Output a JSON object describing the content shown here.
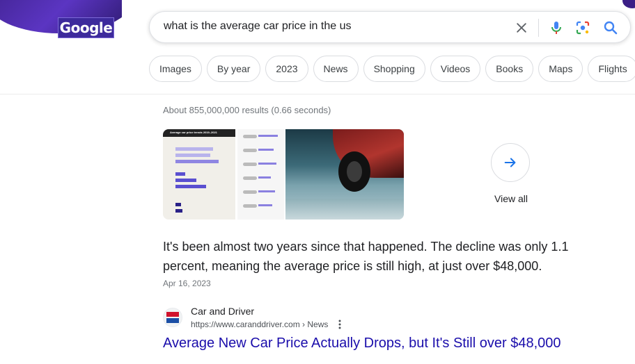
{
  "header": {
    "logo_text": "Google",
    "search": {
      "query": "what is the average car price in the us",
      "placeholder": ""
    }
  },
  "icons": {
    "clear": "close-icon",
    "voice": "microphone-icon",
    "lens": "camera-lens-icon",
    "search": "search-icon",
    "view_all": "arrow-right-icon",
    "more": "more-vert-icon"
  },
  "chips": [
    "Images",
    "By year",
    "2023",
    "News",
    "Shopping",
    "Videos",
    "Books",
    "Maps",
    "Flights"
  ],
  "result_stats": "About 855,000,000 results (0.66 seconds)",
  "images": {
    "chart_title": "Average car price trends 2019–2021",
    "view_all_label": "View all"
  },
  "featured": {
    "snippet": "It's been almost two years since that happened. The decline was only 1.1 percent, meaning the average price is still high, at just over $48,000.",
    "date": "Apr 16, 2023",
    "source": {
      "name": "Car and Driver",
      "url": "https://www.caranddriver.com › News"
    },
    "title": "Average New Car Price Actually Drops, but It's Still over $48,000"
  },
  "colors": {
    "link": "#1a0dab",
    "accent_blue": "#4285f4",
    "doodle_purple": "#3b1f86"
  }
}
